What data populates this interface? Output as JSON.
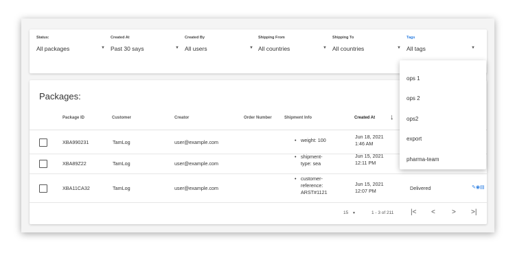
{
  "filters": [
    {
      "label": "Status:",
      "value": "All packages"
    },
    {
      "label": "Created At",
      "value": "Past 30 says"
    },
    {
      "label": "Created By",
      "value": "All users"
    },
    {
      "label": "Shipping From",
      "value": "All countries"
    },
    {
      "label": "Shipping To",
      "value": "All countries"
    },
    {
      "label": "Tags",
      "value": "All tags"
    }
  ],
  "packages": {
    "title": "Packages:",
    "columns": {
      "package_id": "Package ID",
      "customer": "Customer",
      "creator": "Creator",
      "order_number": "Order Number",
      "shipment_info": "Shipment Info",
      "created_at": "Created At"
    },
    "rows": [
      {
        "id": "XBA990231",
        "customer": "TamLog",
        "creator": "user@example.com",
        "info": [
          "weight: 100"
        ],
        "date": "Jun 18, 2021",
        "time": "1:46 AM",
        "status": ""
      },
      {
        "id": "XBA89Z22",
        "customer": "TamLog",
        "creator": "user@example.com",
        "info": [
          "shipment-",
          "type: sea"
        ],
        "date": "Jun 15, 2021",
        "time": "12:11 PM",
        "status": ""
      },
      {
        "id": "XBA11CA32",
        "customer": "TamLog",
        "creator": "user@example.com",
        "info": [
          "customer-",
          "reference:",
          "ARST#1121"
        ],
        "date": "Jun 15, 2021",
        "time": "12:07 PM",
        "status": "Delivered"
      }
    ]
  },
  "pagination": {
    "page_size": "15",
    "range": "1 - 3 of 211",
    "first": "|<",
    "prev": "<",
    "next": ">",
    "last": ">|"
  },
  "tags_menu": {
    "items": [
      "ops 1",
      "ops 2",
      "ops2",
      "export",
      "pharma-team"
    ]
  },
  "icons": {
    "dropdown_chevron": "▼",
    "sort": "↓",
    "actions": "edit-globe-doc"
  },
  "colors": {
    "accent": "#2a7de1"
  }
}
